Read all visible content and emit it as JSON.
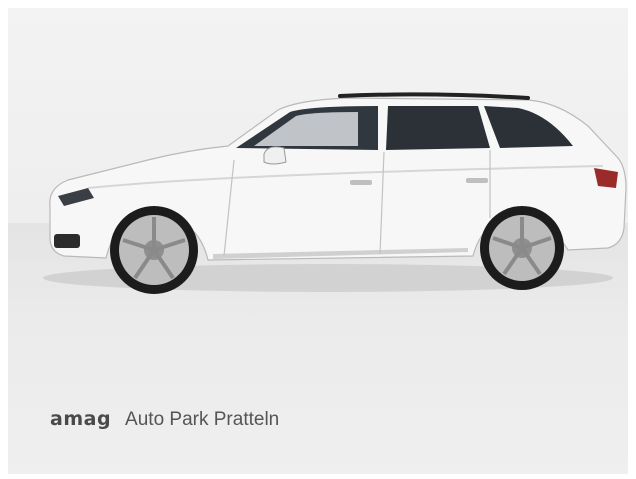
{
  "listing": {
    "image_subject": "white station wagon side view",
    "dealer": {
      "brand_logo": "amag",
      "location_name": "Auto Park Pratteln"
    }
  },
  "colors": {
    "background_top": "#f3f3f3",
    "background_floor": "#e8e8e8",
    "car_body": "#f7f7f7",
    "window_tint": "#2c3137",
    "logo_text": "#4a4a4a"
  }
}
